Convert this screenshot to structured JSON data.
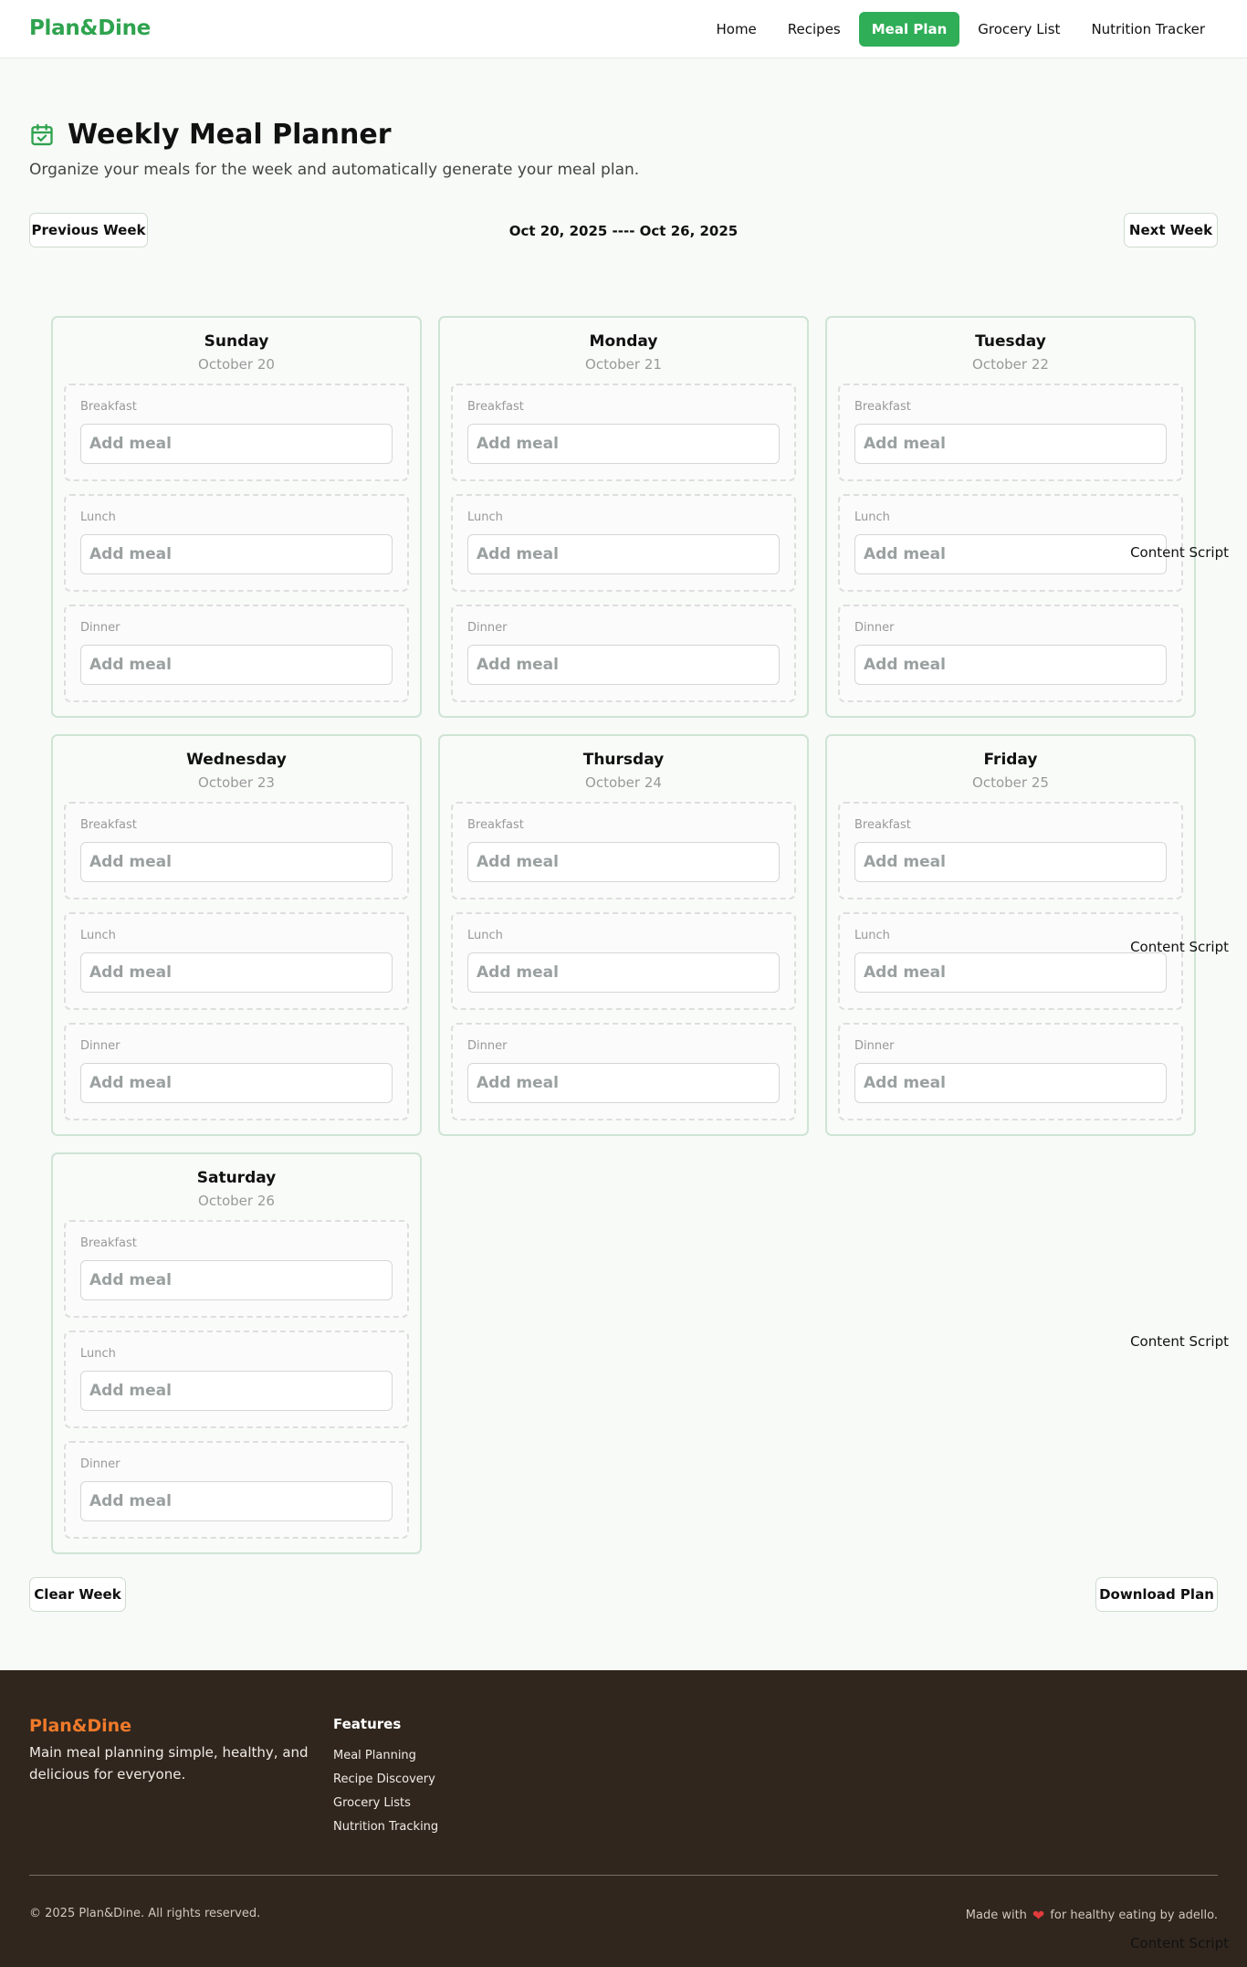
{
  "nav": {
    "brand": "Plan&Dine",
    "links": [
      {
        "label": "Home"
      },
      {
        "label": "Recipes"
      },
      {
        "label": "Meal Plan",
        "active": true
      },
      {
        "label": "Grocery List"
      },
      {
        "label": "Nutrition Tracker"
      }
    ]
  },
  "header": {
    "icon": "calendar-check-icon",
    "title": "Weekly Meal Planner",
    "subtitle": "Organize your meals for the week and automatically generate your meal plan."
  },
  "week": {
    "prev_label": "Previous Week",
    "range": "Oct 20, 2025 ---- Oct 26, 2025",
    "next_label": "Next Week"
  },
  "slot_labels": [
    "Breakfast",
    "Lunch",
    "Dinner"
  ],
  "placeholder": "Add meal",
  "days": [
    {
      "name": "Sunday",
      "date": "October 20"
    },
    {
      "name": "Monday",
      "date": "October 21"
    },
    {
      "name": "Tuesday",
      "date": "October 22"
    },
    {
      "name": "Wednesday",
      "date": "October 23"
    },
    {
      "name": "Thursday",
      "date": "October 24"
    },
    {
      "name": "Friday",
      "date": "October 25"
    },
    {
      "name": "Saturday",
      "date": "October 26"
    }
  ],
  "actions": {
    "clear_label": "Clear Week",
    "download_label": "Download Plan"
  },
  "overlay": {
    "content_script": "Content Script"
  },
  "footer": {
    "brand": "Plan&Dine",
    "tagline": "Main meal planning simple, healthy, and delicious for everyone.",
    "features_heading": "Features",
    "features": [
      "Meal Planning",
      "Recipe Discovery",
      "Grocery Lists",
      "Nutrition Tracking"
    ],
    "copyright": "© 2025 Plan&Dine. All rights reserved.",
    "made_prefix": "Made with",
    "made_suffix": "for healthy eating by adello."
  },
  "colors": {
    "brand": "#2fa34f",
    "active_nav": "#2fae57",
    "footer_bg": "#30261e",
    "footer_brand": "#f07a2a",
    "heart": "#e23b3b"
  }
}
